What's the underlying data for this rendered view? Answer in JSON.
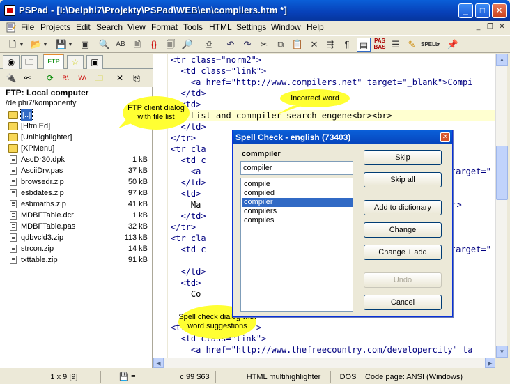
{
  "window": {
    "title": "PSPad - [I:\\Delphi7\\Projekty\\PSPad\\WEB\\en\\compilers.htm *]",
    "minimize": "_",
    "maximize": "□",
    "close": "✕"
  },
  "menu": {
    "items": [
      "File",
      "Projects",
      "Edit",
      "Search",
      "View",
      "Format",
      "Tools",
      "HTML",
      "Settings",
      "Window",
      "Help"
    ]
  },
  "left_panel": {
    "ftp_title": "FTP: Local computer",
    "path": "/delphi7/komponenty",
    "files": [
      {
        "name": "[..]",
        "size": "",
        "type": "folder",
        "selected": true
      },
      {
        "name": "[HtmlEd]",
        "size": "",
        "type": "folder"
      },
      {
        "name": "[Unihighlighter]",
        "size": "",
        "type": "folder"
      },
      {
        "name": "[XPMenu]",
        "size": "",
        "type": "folder"
      },
      {
        "name": "AscDr30.dpk",
        "size": "1 kB",
        "type": "file"
      },
      {
        "name": "AsciiDrv.pas",
        "size": "37 kB",
        "type": "file"
      },
      {
        "name": "browsedr.zip",
        "size": "50 kB",
        "type": "file"
      },
      {
        "name": "esbdates.zip",
        "size": "97 kB",
        "type": "file"
      },
      {
        "name": "esbmaths.zip",
        "size": "41 kB",
        "type": "file"
      },
      {
        "name": "MDBFTable.dcr",
        "size": "1 kB",
        "type": "file"
      },
      {
        "name": "MDBFTable.pas",
        "size": "32 kB",
        "type": "file"
      },
      {
        "name": "qdbvcld3.zip",
        "size": "113 kB",
        "type": "file"
      },
      {
        "name": "strcon.zip",
        "size": "14 kB",
        "type": "file"
      },
      {
        "name": "txttable.zip",
        "size": "91 kB",
        "type": "file"
      }
    ]
  },
  "editor": {
    "lines": [
      "<tr class=\"norm2\">",
      "  <td class=\"link\">",
      "    <a href=\"http://www.compilers.net\" target=\"_blank\">Compi",
      "  </td>",
      "  <td>",
      "    List and commpiler search engene<br><br>",
      "  </td>",
      "</tr>",
      "<tr cla",
      "  <td c",
      "    <a",
      "  </td>",
      "  <td>",
      "    Ma",
      "  </td>",
      "</tr>",
      "<tr cla",
      "  <td c",
      "",
      "  </td>",
      "  <td>",
      "    Co",
      "",
      "",
      "<tr class=\"norm2\">",
      "  <td class=\"link\">",
      "    <a href=\"http://www.thefreecountry.com/developercity\" ta"
    ],
    "fragments": {
      "line10": "target=\"_",
      "line14": "br>",
      "line18": "target=\""
    }
  },
  "balloons": {
    "ftp": "FTP client dialog with file list",
    "incorrect": "Incorrect word",
    "spell": "Spell check dialog with word suggestions"
  },
  "dialog": {
    "title": "Spell Check - english (73403)",
    "word": "commpiler",
    "input_value": "compiler",
    "suggestions": [
      "compile",
      "compiled",
      "compiler",
      "compilers",
      "compiles"
    ],
    "selected_index": 2,
    "buttons": {
      "skip": "Skip",
      "skip_all": "Skip all",
      "add": "Add to dictionary",
      "change": "Change",
      "change_add": "Change + add",
      "undo": "Undo",
      "cancel": "Cancel"
    }
  },
  "status": {
    "position": "1 x 9   [9]",
    "char": "c   99  $63",
    "highlighter": "HTML multihighlighter",
    "format": "DOS",
    "codepage": "Code page: ANSI (Windows)"
  }
}
